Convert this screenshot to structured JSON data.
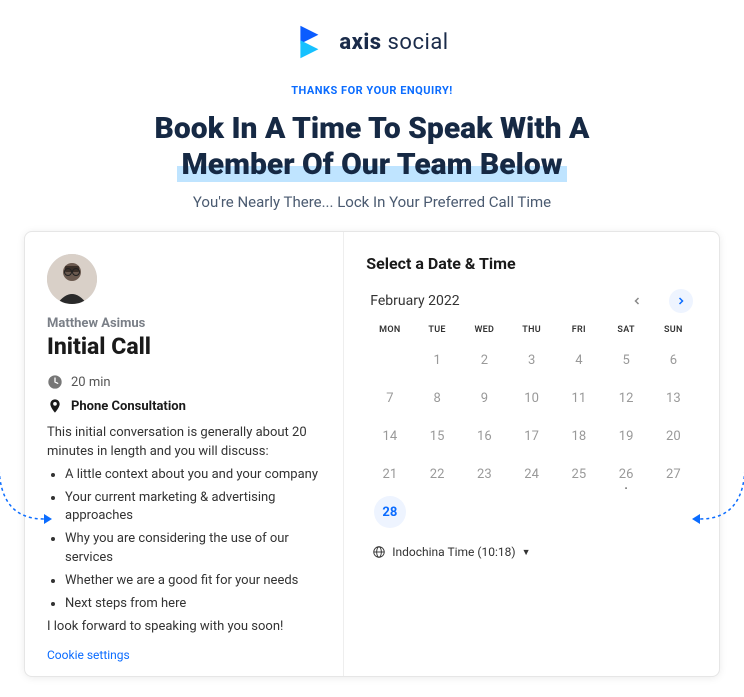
{
  "brand": {
    "name_bold": "axis",
    "name_light": "social"
  },
  "hero": {
    "eyebrow": "THANKS FOR YOUR ENQUIRY!",
    "headline_line1": "Book In A Time To Speak With A",
    "headline_line2": "Member Of Our Team Below",
    "sub": "You're Nearly There... Lock In Your Preferred Call Time"
  },
  "event": {
    "host": "Matthew Asimus",
    "title": "Initial Call",
    "duration": "20 min",
    "location": "Phone Consultation",
    "desc_intro": "This initial conversation is generally about 20 minutes in length and you will discuss:",
    "bullets": [
      "A little context about you and your company",
      "Your current marketing & advertising approaches",
      "Why you are considering the use of our services",
      "Whether we are a good fit for your needs",
      "Next steps from here"
    ],
    "desc_outro": "I look forward to speaking with you soon!"
  },
  "cookie_link": "Cookie settings",
  "calendar": {
    "heading": "Select a Date & Time",
    "month": "February 2022",
    "dow": [
      "MON",
      "TUE",
      "WED",
      "THU",
      "FRI",
      "SAT",
      "SUN"
    ],
    "lead_blanks": 1,
    "days": [
      {
        "n": 1
      },
      {
        "n": 2
      },
      {
        "n": 3
      },
      {
        "n": 4
      },
      {
        "n": 5
      },
      {
        "n": 6
      },
      {
        "n": 7
      },
      {
        "n": 8
      },
      {
        "n": 9
      },
      {
        "n": 10
      },
      {
        "n": 11
      },
      {
        "n": 12
      },
      {
        "n": 13
      },
      {
        "n": 14
      },
      {
        "n": 15
      },
      {
        "n": 16
      },
      {
        "n": 17
      },
      {
        "n": 18
      },
      {
        "n": 19
      },
      {
        "n": 20
      },
      {
        "n": 21
      },
      {
        "n": 22
      },
      {
        "n": 23
      },
      {
        "n": 24
      },
      {
        "n": 25
      },
      {
        "n": 26,
        "today": true
      },
      {
        "n": 27
      },
      {
        "n": 28,
        "available": true
      }
    ],
    "timezone": "Indochina Time (10:18)"
  }
}
